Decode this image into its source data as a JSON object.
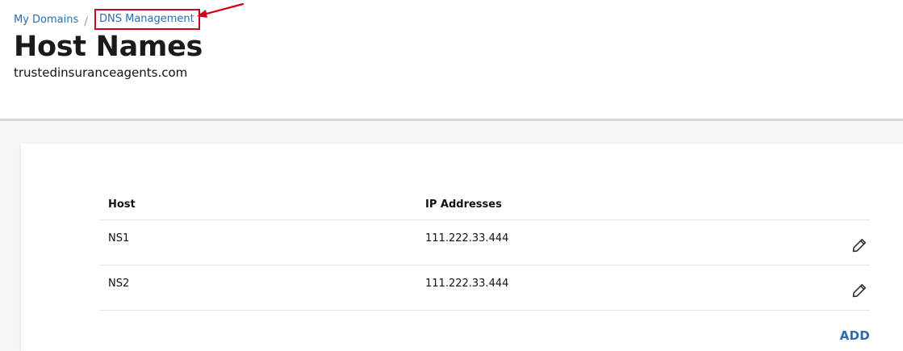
{
  "breadcrumb": {
    "parent_label": "My Domains",
    "separator": "/",
    "current_label": "DNS Management"
  },
  "page": {
    "title": "Host Names",
    "domain": "trustedinsuranceagents.com"
  },
  "table": {
    "columns": [
      "Host",
      "IP Addresses"
    ],
    "rows": [
      {
        "host": "NS1",
        "ip": "111.222.33.444",
        "action_icon": "pencil-icon"
      },
      {
        "host": "NS2",
        "ip": "111.222.33.444",
        "action_icon": "pencil-icon"
      }
    ]
  },
  "actions": {
    "add_label": "ADD"
  },
  "colors": {
    "link": "#2b6cb0",
    "annotation": "#d0021b",
    "page_background": "#f4f5f6"
  }
}
